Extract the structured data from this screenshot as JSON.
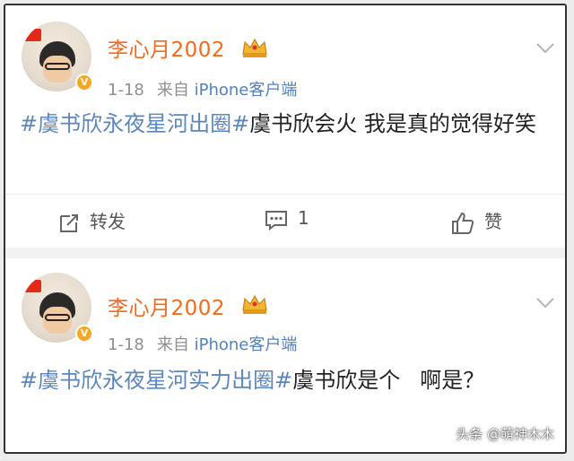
{
  "posts": [
    {
      "username": "李心月2002",
      "time": "1-18",
      "source_prefix": "来自 ",
      "source": "iPhone客户端",
      "content": {
        "tag1": "#虞书欣永夜星河出圈#",
        "tag2": "虞书欣会火",
        "text": " 我是真的觉得好笑"
      },
      "actions": {
        "repost": "转发",
        "comment_count": "1",
        "like": "赞"
      }
    },
    {
      "username": "李心月2002",
      "time": "1-18",
      "source_prefix": "来自 ",
      "source": "iPhone客户端",
      "content": {
        "tag1": "#虞书欣永夜星河实力出圈#",
        "tag2": "虞书欣是个",
        "text": "啊是？"
      }
    }
  ],
  "watermark": "头条 @萌神木木",
  "icons": {
    "verified": "verified-badge-icon",
    "crown": "crown-icon",
    "chevron": "chevron-down-icon",
    "repost": "repost-icon",
    "comment": "comment-icon",
    "like": "thumbs-up-icon"
  },
  "colors": {
    "username": "#f06b1e",
    "hashtag": "#5d86bd",
    "source": "#5580b8",
    "meta": "#8f8f8f"
  }
}
